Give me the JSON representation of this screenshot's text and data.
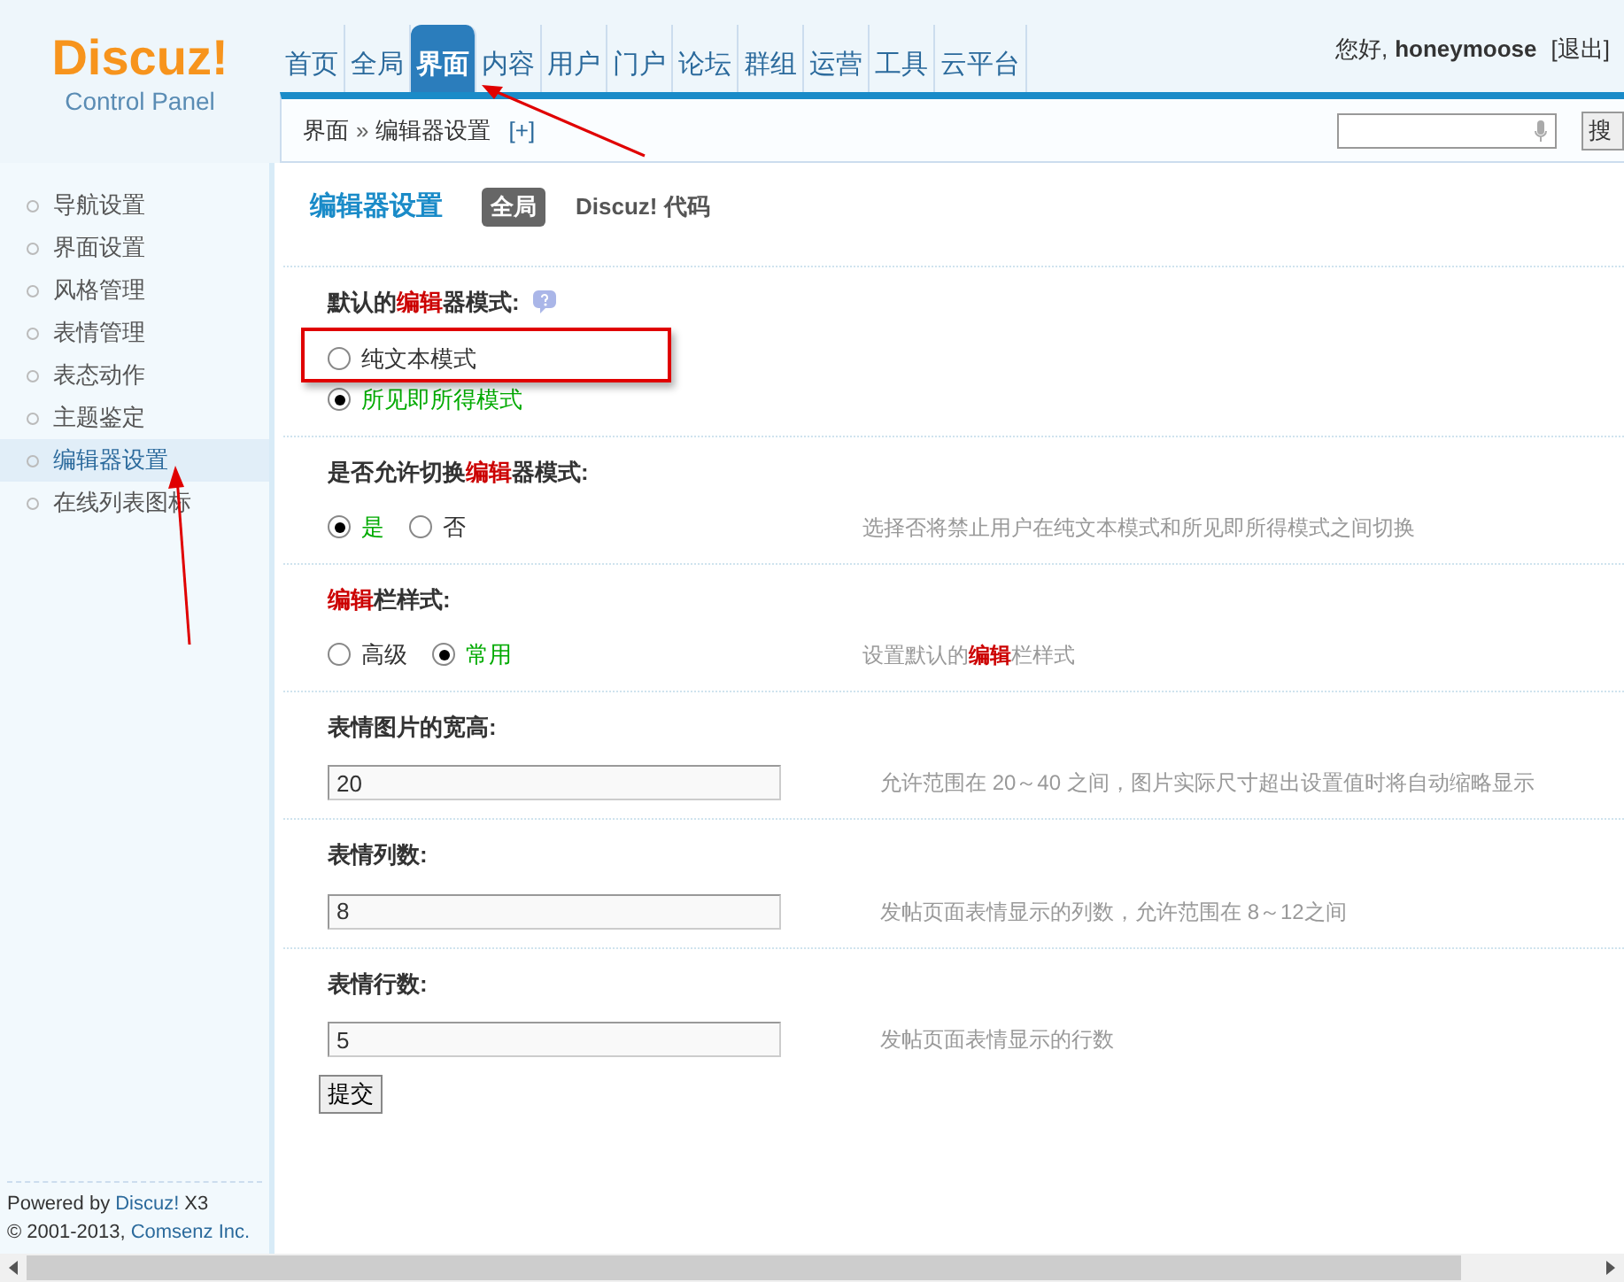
{
  "logo": {
    "title": "Discuz!",
    "subtitle": "Control Panel"
  },
  "nav": [
    {
      "label": "首页",
      "selected": false
    },
    {
      "label": "全局",
      "selected": false
    },
    {
      "label": "界面",
      "selected": true
    },
    {
      "label": "内容",
      "selected": false
    },
    {
      "label": "用户",
      "selected": false
    },
    {
      "label": "门户",
      "selected": false
    },
    {
      "label": "论坛",
      "selected": false
    },
    {
      "label": "群组",
      "selected": false
    },
    {
      "label": "运营",
      "selected": false
    },
    {
      "label": "工具",
      "selected": false
    },
    {
      "label": "云平台",
      "selected": false
    }
  ],
  "user": {
    "greeting": "您好,",
    "name": "honeymoose",
    "logout": "[退出]"
  },
  "breadcrumb": {
    "items": [
      "界面",
      "编辑器设置"
    ],
    "separator": "»",
    "add": "[+]"
  },
  "search": {
    "button": "搜"
  },
  "sidebar": [
    {
      "label": "导航设置",
      "selected": false
    },
    {
      "label": "界面设置",
      "selected": false
    },
    {
      "label": "风格管理",
      "selected": false
    },
    {
      "label": "表情管理",
      "selected": false
    },
    {
      "label": "表态动作",
      "selected": false
    },
    {
      "label": "主题鉴定",
      "selected": false
    },
    {
      "label": "编辑器设置",
      "selected": true
    },
    {
      "label": "在线列表图标",
      "selected": false
    }
  ],
  "footer": {
    "powered": "Powered by",
    "brand": "Discuz!",
    "version": "X3",
    "copyright": "© 2001-2013,",
    "company": "Comsenz Inc."
  },
  "page": {
    "title": "编辑器设置",
    "tabs": [
      {
        "label": "全局",
        "selected": true
      },
      {
        "label": "Discuz! 代码",
        "selected": false
      }
    ]
  },
  "settings": [
    {
      "kind": "radio",
      "label": [
        {
          "text": "默认的",
          "highlight": false
        },
        {
          "text": "编辑",
          "highlight": true
        },
        {
          "text": "器模式:",
          "highlight": false
        }
      ],
      "help": true,
      "stacked": true,
      "options": [
        {
          "label": "纯文本模式",
          "selected": false
        },
        {
          "label": "所见即所得模式",
          "selected": true
        }
      ]
    },
    {
      "kind": "radio",
      "label": [
        {
          "text": "是否允许切换",
          "highlight": false
        },
        {
          "text": "编辑",
          "highlight": true
        },
        {
          "text": "器模式:",
          "highlight": false
        }
      ],
      "help": false,
      "stacked": false,
      "options": [
        {
          "label": "是",
          "selected": true
        },
        {
          "label": "否",
          "selected": false
        }
      ],
      "hint": [
        {
          "text": "选择否将禁止用户在纯文本模式和所见即所得模式之间切换",
          "highlight": false
        }
      ]
    },
    {
      "kind": "radio",
      "label": [
        {
          "text": "编辑",
          "highlight": true
        },
        {
          "text": "栏样式:",
          "highlight": false
        }
      ],
      "help": false,
      "stacked": false,
      "options": [
        {
          "label": "高级",
          "selected": false
        },
        {
          "label": "常用",
          "selected": true
        }
      ],
      "hint": [
        {
          "text": "设置默认的",
          "highlight": false
        },
        {
          "text": "编辑",
          "highlight": true
        },
        {
          "text": "栏样式",
          "highlight": false
        }
      ]
    },
    {
      "kind": "text",
      "label": [
        {
          "text": "表情图片的宽高:",
          "highlight": false
        }
      ],
      "help": false,
      "value": "20",
      "hint": [
        {
          "text": "允许范围在 20～40 之间，图片实际尺寸超出设置值时将自动缩略显示",
          "highlight": false
        }
      ]
    },
    {
      "kind": "text",
      "label": [
        {
          "text": "表情列数:",
          "highlight": false
        }
      ],
      "help": false,
      "value": "8",
      "hint": [
        {
          "text": "发帖页面表情显示的列数，允许范围在 8～12之间",
          "highlight": false
        }
      ]
    },
    {
      "kind": "text",
      "label": [
        {
          "text": "表情行数:",
          "highlight": false
        }
      ],
      "help": false,
      "value": "5",
      "hint": [
        {
          "text": "发帖页面表情显示的行数",
          "highlight": false
        }
      ]
    }
  ],
  "submit": "提交"
}
